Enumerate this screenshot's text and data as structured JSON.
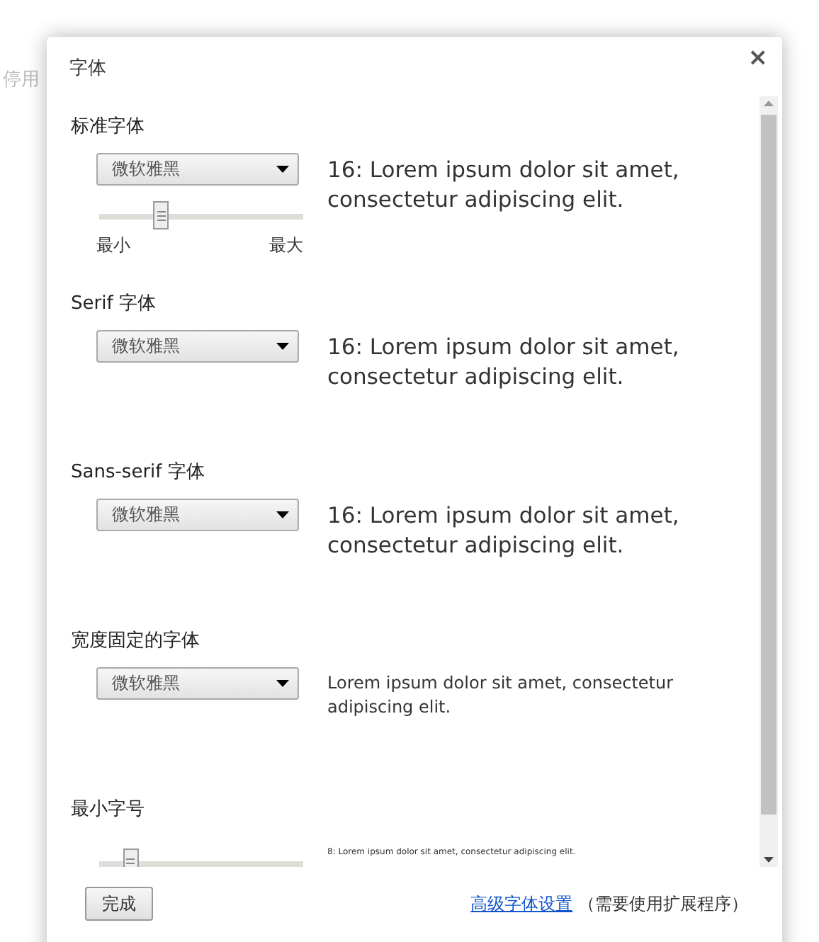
{
  "background_text": "停用",
  "dialog": {
    "title": "字体",
    "close": "×",
    "sections": [
      {
        "kind": "sized-font",
        "label": "标准字体",
        "font": "微软雅黑",
        "slider": {
          "level": 0.3,
          "min_label": "最小",
          "max_label": "最大"
        },
        "preview": "16: Lorem ipsum dolor sit amet, consectetur adipiscing elit."
      },
      {
        "kind": "font",
        "label": "Serif 字体",
        "font": "微软雅黑",
        "preview": "16: Lorem ipsum dolor sit amet, consectetur adipiscing elit."
      },
      {
        "kind": "font",
        "label": "Sans-serif 字体",
        "font": "微软雅黑",
        "preview": "16: Lorem ipsum dolor sit amet, consectetur adipiscing elit."
      },
      {
        "kind": "fixed-font",
        "label": "宽度固定的字体",
        "font": "微软雅黑",
        "preview": "Lorem ipsum dolor sit amet, consectetur adipiscing elit."
      },
      {
        "kind": "minimum-size",
        "label": "最小字号",
        "slider": {
          "level": 0.15
        },
        "preview": "8: Lorem ipsum dolor sit amet, consectetur adipiscing elit."
      }
    ],
    "done_button": "完成",
    "link": "高级字体设置",
    "link_note": "（需要使用扩展程序）"
  }
}
